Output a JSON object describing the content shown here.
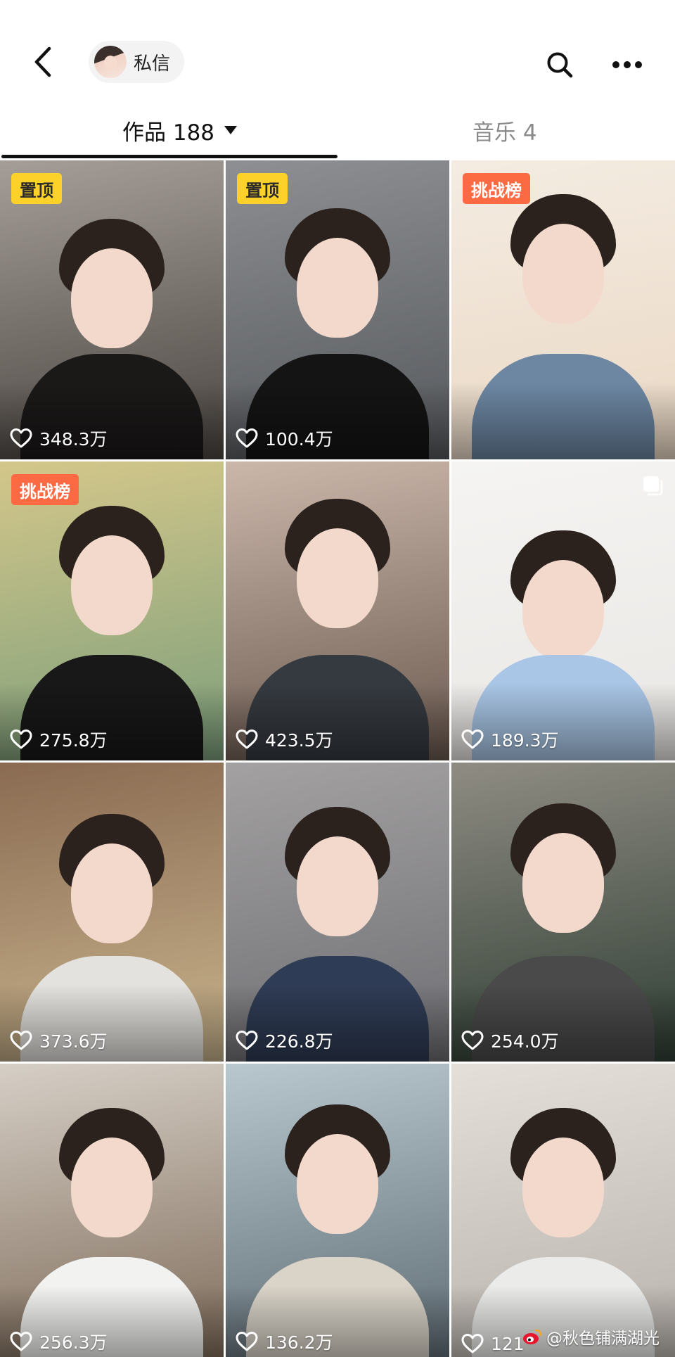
{
  "header": {
    "back_icon": "chevron-left-icon",
    "dm_label": "私信",
    "search_icon": "search-icon",
    "more_icon": "more-horizontal-icon"
  },
  "tabs": [
    {
      "label": "作品 188",
      "active": true
    },
    {
      "label": "音乐 4",
      "active": false
    }
  ],
  "videos": [
    {
      "likes": "348.3万",
      "badge": "置顶",
      "badge_type": "pinned",
      "bg": "#4a4541",
      "bg2": "#a59e98",
      "outfit": "#1b1818"
    },
    {
      "likes": "100.4万",
      "badge": "置顶",
      "badge_type": "pinned",
      "bg": "#55585c",
      "bg2": "#8d8f92",
      "outfit": "#141414"
    },
    {
      "likes": "",
      "badge": "挑战榜",
      "badge_type": "chart",
      "bg": "#ead8c4",
      "bg2": "#f4ece2",
      "outfit": "#6d87a3"
    },
    {
      "likes": "275.8万",
      "badge": "挑战榜",
      "badge_type": "chart",
      "bg": "#7c9e7b",
      "bg2": "#d4c78a",
      "outfit": "#181818"
    },
    {
      "likes": "423.5万",
      "badge": "",
      "badge_type": "",
      "bg": "#6b5a50",
      "bg2": "#cbb7aa",
      "outfit": "#353a40"
    },
    {
      "likes": "189.3万",
      "badge": "",
      "badge_type": "",
      "multi": true,
      "bg": "#e9e7e4",
      "bg2": "#f5f4f2",
      "outfit": "#a9c6e6"
    },
    {
      "likes": "373.6万",
      "badge": "",
      "badge_type": "",
      "bg": "#c9b48d",
      "bg2": "#8a6b52",
      "outfit": "#e4e2de"
    },
    {
      "likes": "226.8万",
      "badge": "",
      "badge_type": "",
      "bg": "#6e6e73",
      "bg2": "#a3a1a1",
      "outfit": "#2f3c55"
    },
    {
      "likes": "254.0万",
      "badge": "",
      "badge_type": "",
      "bg": "#2f3e34",
      "bg2": "#8f8c83",
      "outfit": "#4a4a4a"
    },
    {
      "likes": "256.3万",
      "badge": "",
      "badge_type": "",
      "bg": "#7d6a58",
      "bg2": "#d6cfc6",
      "outfit": "#f2f2f0"
    },
    {
      "likes": "136.2万",
      "badge": "",
      "badge_type": "",
      "bg": "#5e6b73",
      "bg2": "#b9c8cf",
      "outfit": "#d9d3c8"
    },
    {
      "likes": "121",
      "badge": "",
      "badge_type": "",
      "bg": "#b8b2ac",
      "bg2": "#e4dfd9",
      "outfit": "#ebebea"
    }
  ],
  "watermark": {
    "icon": "weibo-icon",
    "text": "@秋色铺满湖光"
  },
  "colors": {
    "pinned_badge": "#fcd22a",
    "chart_badge": "#fb6a43",
    "active_tab": "#111111",
    "inactive_tab": "#8a8a8a"
  }
}
